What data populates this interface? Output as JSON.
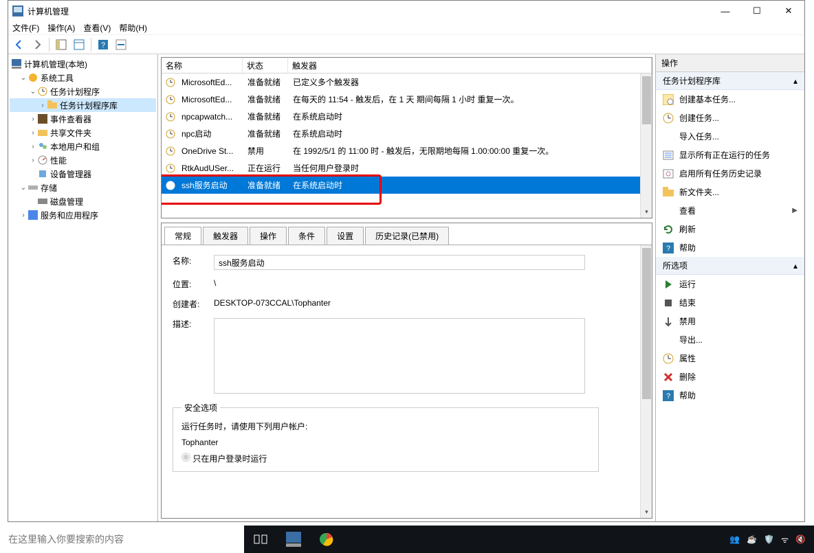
{
  "window": {
    "title": "计算机管理",
    "min": "—",
    "max": "☐",
    "close": "✕"
  },
  "menus": [
    "文件(F)",
    "操作(A)",
    "查看(V)",
    "帮助(H)"
  ],
  "tree": {
    "root": "计算机管理(本地)",
    "sys_tools": "系统工具",
    "task_sched": "任务计划程序",
    "task_lib": "任务计划程序库",
    "event_viewer": "事件查看器",
    "shared_folders": "共享文件夹",
    "local_users": "本地用户和组",
    "performance": "性能",
    "device_mgr": "设备管理器",
    "storage": "存储",
    "disk_mgmt": "磁盘管理",
    "services_apps": "服务和应用程序"
  },
  "task_columns": {
    "name": "名称",
    "status": "状态",
    "trigger": "触发器"
  },
  "tasks": [
    {
      "name": "MicrosoftEd...",
      "status": "准备就绪",
      "trigger": "已定义多个触发器"
    },
    {
      "name": "MicrosoftEd...",
      "status": "准备就绪",
      "trigger": "在每天的 11:54 - 触发后，在 1 天 期间每隔 1 小时 重复一次。"
    },
    {
      "name": "npcapwatch...",
      "status": "准备就绪",
      "trigger": "在系统启动时"
    },
    {
      "name": "npc启动",
      "status": "准备就绪",
      "trigger": "在系统启动时"
    },
    {
      "name": "OneDrive St...",
      "status": "禁用",
      "trigger": "在 1992/5/1 的 11:00 时 - 触发后，无限期地每隔 1.00:00:00 重复一次。"
    },
    {
      "name": "RtkAudUSer...",
      "status": "正在运行",
      "trigger": "当任何用户登录时"
    },
    {
      "name": "ssh服务启动",
      "status": "准备就绪",
      "trigger": "在系统启动时"
    }
  ],
  "detail_tabs": [
    "常规",
    "触发器",
    "操作",
    "条件",
    "设置",
    "历史记录(已禁用)"
  ],
  "detail": {
    "name_label": "名称:",
    "name_value": "ssh服务启动",
    "location_label": "位置:",
    "location_value": "\\",
    "author_label": "创建者:",
    "author_value": "DESKTOP-073CCAL\\Tophanter",
    "desc_label": "描述:",
    "security_legend": "安全选项",
    "security_text": "运行任务时，请使用下列用户帐户:",
    "security_user": "Tophanter",
    "run_only_logged": "只在用户登录时运行"
  },
  "actions": {
    "header": "操作",
    "section1": "任务计划程序库",
    "items1": [
      {
        "label": "创建基本任务...",
        "icon": "clock"
      },
      {
        "label": "创建任务...",
        "icon": "clock-o"
      },
      {
        "label": "导入任务...",
        "icon": "none"
      },
      {
        "label": "显示所有正在运行的任务",
        "icon": "list"
      },
      {
        "label": "启用所有任务历史记录",
        "icon": "history"
      },
      {
        "label": "新文件夹...",
        "icon": "folder"
      },
      {
        "label": "查看",
        "icon": "none",
        "arrow": true
      },
      {
        "label": "刷新",
        "icon": "refresh"
      },
      {
        "label": "帮助",
        "icon": "help"
      }
    ],
    "section2": "所选项",
    "items2": [
      {
        "label": "运行",
        "icon": "play"
      },
      {
        "label": "结束",
        "icon": "stop"
      },
      {
        "label": "禁用",
        "icon": "disable"
      },
      {
        "label": "导出...",
        "icon": "none"
      },
      {
        "label": "属性",
        "icon": "clock-o"
      },
      {
        "label": "删除",
        "icon": "delete"
      },
      {
        "label": "帮助",
        "icon": "help"
      }
    ]
  },
  "taskbar": {
    "search_placeholder": "在这里输入你要搜索的内容"
  }
}
